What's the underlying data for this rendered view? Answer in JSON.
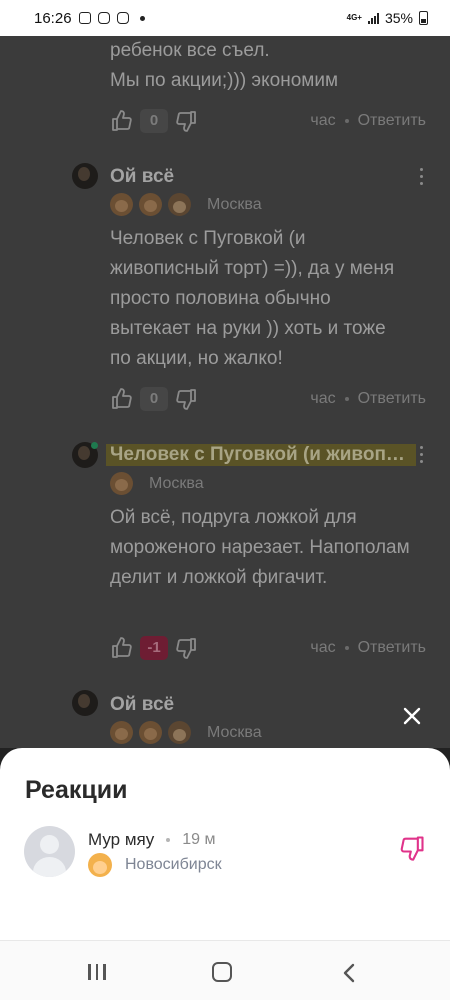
{
  "status_bar": {
    "time": "16:26",
    "network": "4G+",
    "battery": "35%"
  },
  "comments": [
    {
      "text_lines": [
        "ребенок все съел.",
        "Мы по акции;))) экономим"
      ],
      "likes": "0",
      "time": "час",
      "reply_label": "Ответить"
    },
    {
      "author": "Ой всё",
      "city": "Москва",
      "text": "Человек с Пуговкой (и живописный торт) =)), да у меня просто половина обычно вытекает на руки )) хоть и тоже по акции, но жалко!",
      "likes": "0",
      "time": "час",
      "reply_label": "Ответить"
    },
    {
      "author": "Человек с Пуговкой (и живописный торт)",
      "city": "Москва",
      "text": "Ой всё, подруга ложкой для мороженого нарезает. Напополам делит и ложкой фигачит.",
      "likes": "-1",
      "time": "час",
      "reply_label": "Ответить"
    },
    {
      "author": "Ой всё",
      "city": "Москва"
    }
  ],
  "reactions_sheet": {
    "title": "Реакции",
    "items": [
      {
        "name": "Мур мяу",
        "time": "19 м",
        "city": "Новосибирск",
        "reaction": "dislike-icon",
        "reaction_color": "#e0338a"
      }
    ]
  },
  "colors": {
    "overlay": "#3b3b3b",
    "highlight": "#5a5326",
    "negative_badge": "#6e1d33",
    "sheet_bg": "#ffffff"
  }
}
